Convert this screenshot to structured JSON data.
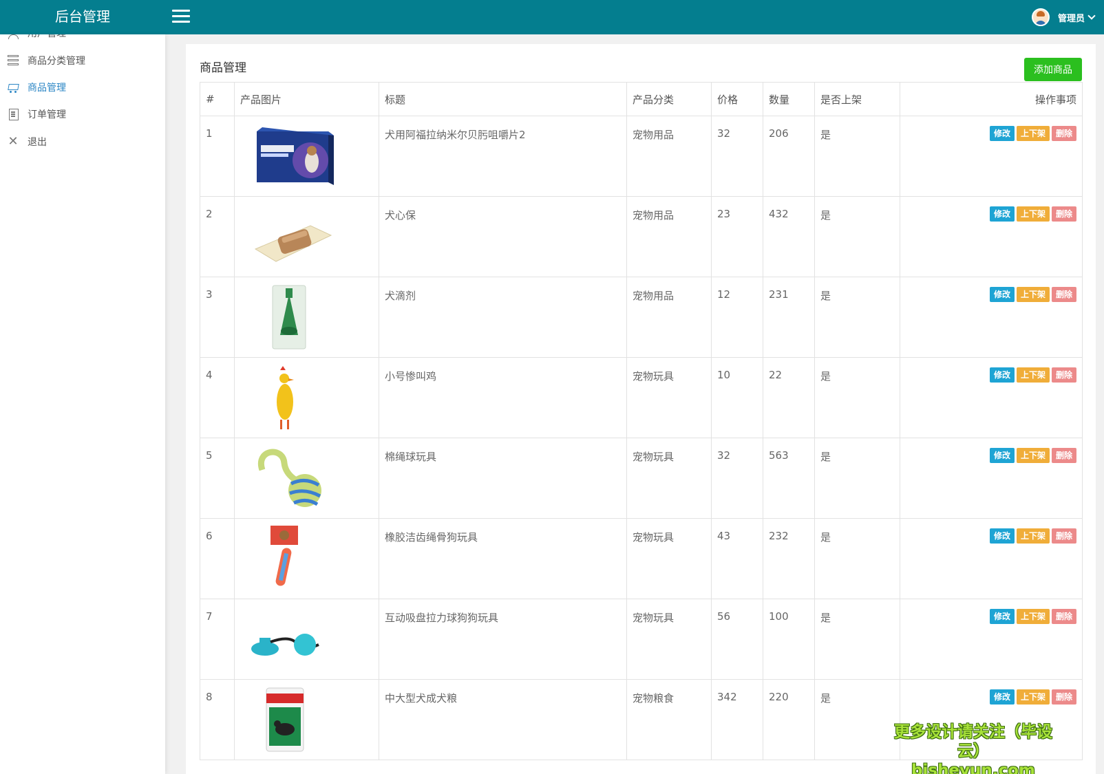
{
  "header": {
    "brand": "后台管理",
    "user_name": "管理员"
  },
  "sidebar": {
    "items": [
      {
        "label": "用户管理",
        "icon": "user-icon",
        "active": false
      },
      {
        "label": "商品分类管理",
        "icon": "list-icon",
        "active": false
      },
      {
        "label": "商品管理",
        "icon": "cart-icon",
        "active": true
      },
      {
        "label": "订单管理",
        "icon": "document-icon",
        "active": false
      },
      {
        "label": "退出",
        "icon": "close-icon",
        "active": false
      }
    ]
  },
  "main": {
    "title": "商品管理",
    "add_button": "添加商品",
    "columns": [
      "#",
      "产品图片",
      "标题",
      "产品分类",
      "价格",
      "数量",
      "是否上架",
      "操作事项"
    ],
    "actions": {
      "edit": "修改",
      "shelf": "上下架",
      "delete": "删除"
    },
    "rows": [
      {
        "id": "1",
        "image": "nexgard-chewable-box",
        "title": "犬用阿福拉纳米尔贝肟咀嚼片2",
        "category": "宠物用品",
        "price": "32",
        "qty": "206",
        "listed": "是"
      },
      {
        "id": "2",
        "image": "heartworm-chew-tablet",
        "title": "犬心保",
        "category": "宠物用品",
        "price": "23",
        "qty": "432",
        "listed": "是"
      },
      {
        "id": "3",
        "image": "flea-drops-pack",
        "title": "犬滴剂",
        "category": "宠物用品",
        "price": "12",
        "qty": "231",
        "listed": "是"
      },
      {
        "id": "4",
        "image": "rubber-chicken-toy",
        "title": "小号惨叫鸡",
        "category": "宠物玩具",
        "price": "10",
        "qty": "22",
        "listed": "是"
      },
      {
        "id": "5",
        "image": "rope-ball-toy",
        "title": "棉绳球玩具",
        "category": "宠物玩具",
        "price": "32",
        "qty": "563",
        "listed": "是"
      },
      {
        "id": "6",
        "image": "rubber-bone-rope-toy",
        "title": "橡胶洁齿绳骨狗玩具",
        "category": "宠物玩具",
        "price": "43",
        "qty": "232",
        "listed": "是"
      },
      {
        "id": "7",
        "image": "suction-ball-toy",
        "title": "互动吸盘拉力球狗狗玩具",
        "category": "宠物玩具",
        "price": "56",
        "qty": "100",
        "listed": "是"
      },
      {
        "id": "8",
        "image": "dog-food-bag",
        "title": "中大型犬成犬粮",
        "category": "宠物粮食",
        "price": "342",
        "qty": "220",
        "listed": "是"
      }
    ]
  },
  "watermark": {
    "line1": "更多设计请关注（毕设云）",
    "line2": "bisheyun.com"
  }
}
